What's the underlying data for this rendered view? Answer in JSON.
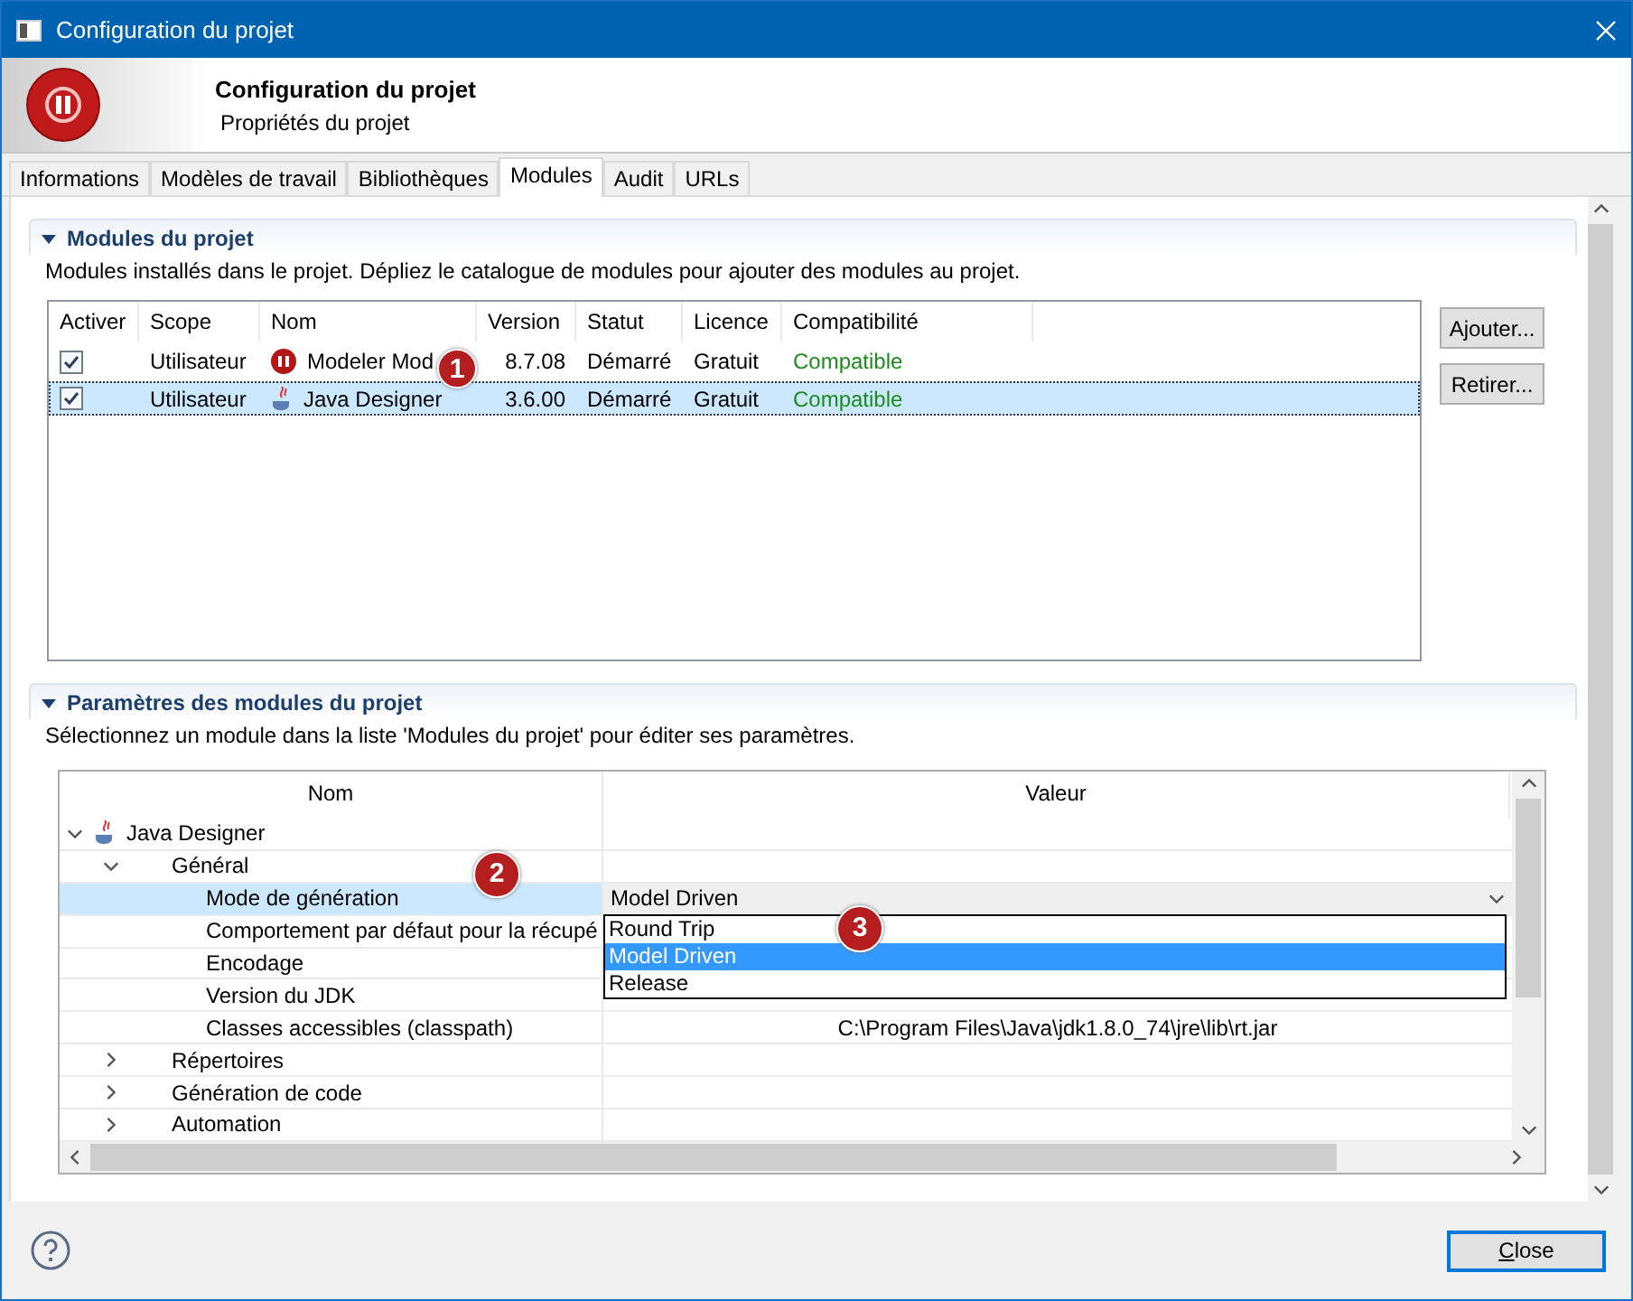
{
  "window": {
    "title": "Configuration du projet"
  },
  "header": {
    "title": "Configuration du projet",
    "subtitle": "Propriétés du projet"
  },
  "tabs": [
    {
      "label": "Informations",
      "selected": false
    },
    {
      "label": "Modèles de travail",
      "selected": false
    },
    {
      "label": "Bibliothèques",
      "selected": false
    },
    {
      "label": "Modules",
      "selected": true
    },
    {
      "label": "Audit",
      "selected": false
    },
    {
      "label": "URLs",
      "selected": false
    }
  ],
  "modules_section": {
    "title": "Modules du projet",
    "expanded": true,
    "description": "Modules installés dans le projet. Dépliez le catalogue de modules pour ajouter des modules au projet.",
    "columns": [
      "Activer",
      "Scope",
      "Nom",
      "Version",
      "Statut",
      "Licence",
      "Compatibilité"
    ],
    "rows": [
      {
        "checked": true,
        "selected": false,
        "scope": "Utilisateur",
        "kind": "modeler",
        "name": "Modeler Mod",
        "callout": "1",
        "version": "8.7.08",
        "status": "Démarré",
        "license": "Gratuit",
        "compatibility": "Compatible"
      },
      {
        "checked": true,
        "selected": true,
        "scope": "Utilisateur",
        "kind": "java",
        "name": "Java Designer",
        "version": "3.6.00",
        "status": "Démarré",
        "license": "Gratuit",
        "compatibility": "Compatible"
      }
    ],
    "buttons": [
      "Ajouter...",
      "Retirer..."
    ]
  },
  "parameters_section": {
    "title": "Paramètres des modules du projet",
    "expanded": true,
    "description": "Sélectionnez un module dans la liste 'Modules du projet' pour éditer ses paramètres.",
    "columns": [
      "Nom",
      "Valeur"
    ],
    "tree": [
      {
        "label": "Java Designer",
        "kind": "module",
        "expanded": true,
        "children": [
          {
            "label": "Général",
            "kind": "group",
            "expanded": true,
            "callout": "2",
            "children": [
              {
                "label": "Mode de génération",
                "selected": true,
                "kind": "combo",
                "value": "Model Driven",
                "value_callout": "3",
                "options": [
                  {
                    "label": "Round Trip",
                    "selected": false
                  },
                  {
                    "label": "Model Driven",
                    "selected": true
                  },
                  {
                    "label": "Release",
                    "selected": false
                  }
                ]
              },
              {
                "label": "Comportement par défaut pour la récupé",
                "selected": false,
                "kind": "text"
              },
              {
                "label": "Encodage",
                "selected": false,
                "kind": "text"
              },
              {
                "label": "Version du JDK",
                "selected": false,
                "kind": "text"
              },
              {
                "label": "Classes accessibles (classpath)",
                "selected": false,
                "kind": "text",
                "value": "C:\\Program Files\\Java\\jdk1.8.0_74\\jre\\lib\\rt.jar"
              }
            ]
          },
          {
            "label": "Répertoires",
            "kind": "group",
            "expanded": false
          },
          {
            "label": "Génération de code",
            "kind": "group",
            "expanded": false
          },
          {
            "label": "Automation",
            "kind": "group",
            "expanded": false
          }
        ]
      }
    ]
  },
  "footer": {
    "close": "Close"
  }
}
